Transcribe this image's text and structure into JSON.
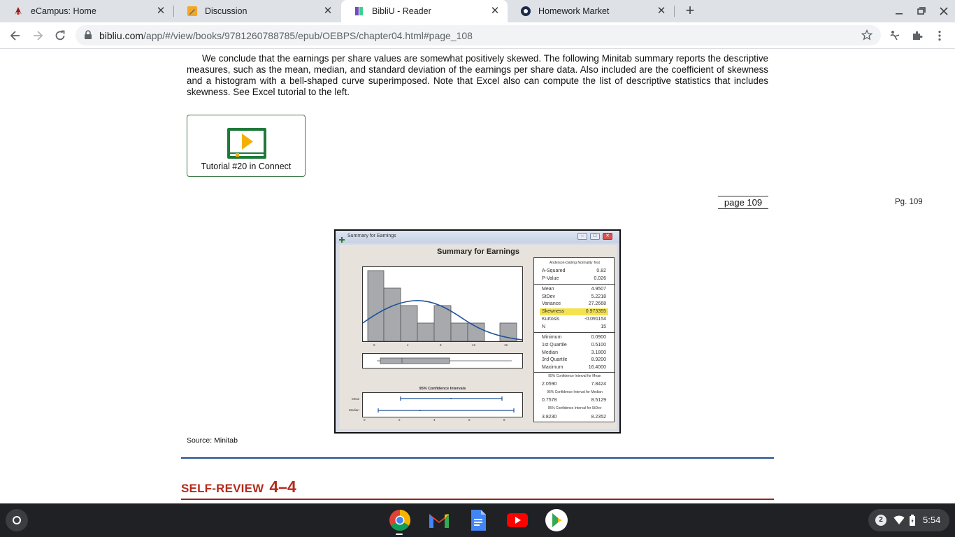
{
  "tabs": [
    {
      "title": "eCampus: Home",
      "icon": "ecampus-logo-icon",
      "active": false
    },
    {
      "title": "Discussion",
      "icon": "pencil-ruler-icon",
      "active": false
    },
    {
      "title": "BibliU - Reader",
      "icon": "bibliu-logo-icon",
      "active": true
    },
    {
      "title": "Homework Market",
      "icon": "homework-market-logo-icon",
      "active": false
    }
  ],
  "address_bar": {
    "domain": "bibliu.com",
    "path": "/app/#/view/books/9781260788785/epub/OEBPS/chapter04.html#page_108"
  },
  "page": {
    "paragraph": "We conclude that the earnings per share values are somewhat positively skewed. The following Minitab summary reports the descriptive measures, such as the mean, median, and standard deviation of the earnings per share data. Also included are the coefficient of skewness and a histogram with a bell-shaped curve superimposed. Note that Excel also can compute the list of descriptive statistics that includes skewness. See Excel tutorial to the left.",
    "tutorial_label": "Tutorial #20 in Connect",
    "page_marker": "page 109",
    "page_right": "Pg. 109",
    "source": "Source: Minitab",
    "self_review_label": "SELF-REVIEW",
    "self_review_number": "4–4"
  },
  "minitab": {
    "window_title": "Summary for Earnings",
    "heading": "Summary for Earnings",
    "hist_ticks": [
      "0",
      "4",
      "8",
      "12",
      "16"
    ],
    "ci_title": "95% Confidence Intervals",
    "ci_labels": {
      "mean": "Mean",
      "median": "Median"
    },
    "ci_ticks": [
      "0",
      "2",
      "4",
      "6",
      "8"
    ],
    "stats": {
      "ad_header": "Anderson-Darling Normality Test",
      "rows_a": [
        [
          "A-Squared",
          "0.82"
        ],
        [
          "P-Value",
          "0.026"
        ]
      ],
      "rows_b": [
        [
          "Mean",
          "4.9507"
        ],
        [
          "StDev",
          "5.2218"
        ],
        [
          "Variance",
          "27.2668"
        ],
        [
          "Skewness",
          "0.973355"
        ],
        [
          "Kurtosis",
          "-0.091154"
        ],
        [
          "N",
          "15"
        ]
      ],
      "rows_c": [
        [
          "Minimum",
          "0.0900"
        ],
        [
          "1st Quartile",
          "0.5100"
        ],
        [
          "Median",
          "3.1800"
        ],
        [
          "3rd Quartile",
          "8.9200"
        ],
        [
          "Maximum",
          "16.4000"
        ]
      ],
      "ci_mean_header": "95% Confidence Interval for Mean",
      "ci_mean": [
        "2.0590",
        "7.8424"
      ],
      "ci_median_header": "95% Confidence Interval for Median",
      "ci_median": [
        "0.7578",
        "8.5129"
      ],
      "ci_stdev_header": "95% Confidence Interval for StDev",
      "ci_stdev": [
        "3.8230",
        "8.2352"
      ]
    }
  },
  "status": {
    "notification_count": "2",
    "time": "5:54"
  }
}
